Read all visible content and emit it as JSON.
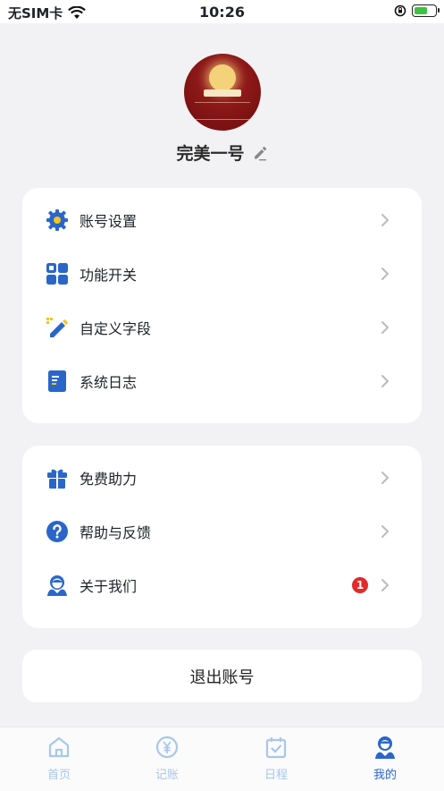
{
  "status": {
    "carrier": "无SIM卡",
    "time": "10:26",
    "battery_level": 0.7
  },
  "profile": {
    "name": "完美一号",
    "avatar_icon": "avatar-image",
    "edit_icon": "pencil-icon"
  },
  "menu_group1": [
    {
      "label": "账号设置",
      "icon": "gear-icon"
    },
    {
      "label": "功能开关",
      "icon": "grid-icon"
    },
    {
      "label": "自定义字段",
      "icon": "edit-field-icon"
    },
    {
      "label": "系统日志",
      "icon": "document-icon"
    }
  ],
  "menu_group2": [
    {
      "label": "免费助力",
      "icon": "gift-icon"
    },
    {
      "label": "帮助与反馈",
      "icon": "question-icon"
    },
    {
      "label": "关于我们",
      "icon": "about-us-icon",
      "badge": "1"
    }
  ],
  "logout_label": "退出账号",
  "tabs": [
    {
      "label": "首页",
      "icon": "home-icon",
      "active": false
    },
    {
      "label": "记账",
      "icon": "yen-icon",
      "active": false
    },
    {
      "label": "日程",
      "icon": "calendar-check-icon",
      "active": false
    },
    {
      "label": "我的",
      "icon": "user-icon",
      "active": true
    }
  ],
  "colors": {
    "accent": "#2a66c9",
    "tab_inactive": "#a8c7ea",
    "badge": "#e02b2b",
    "background": "#f2f2f4"
  }
}
